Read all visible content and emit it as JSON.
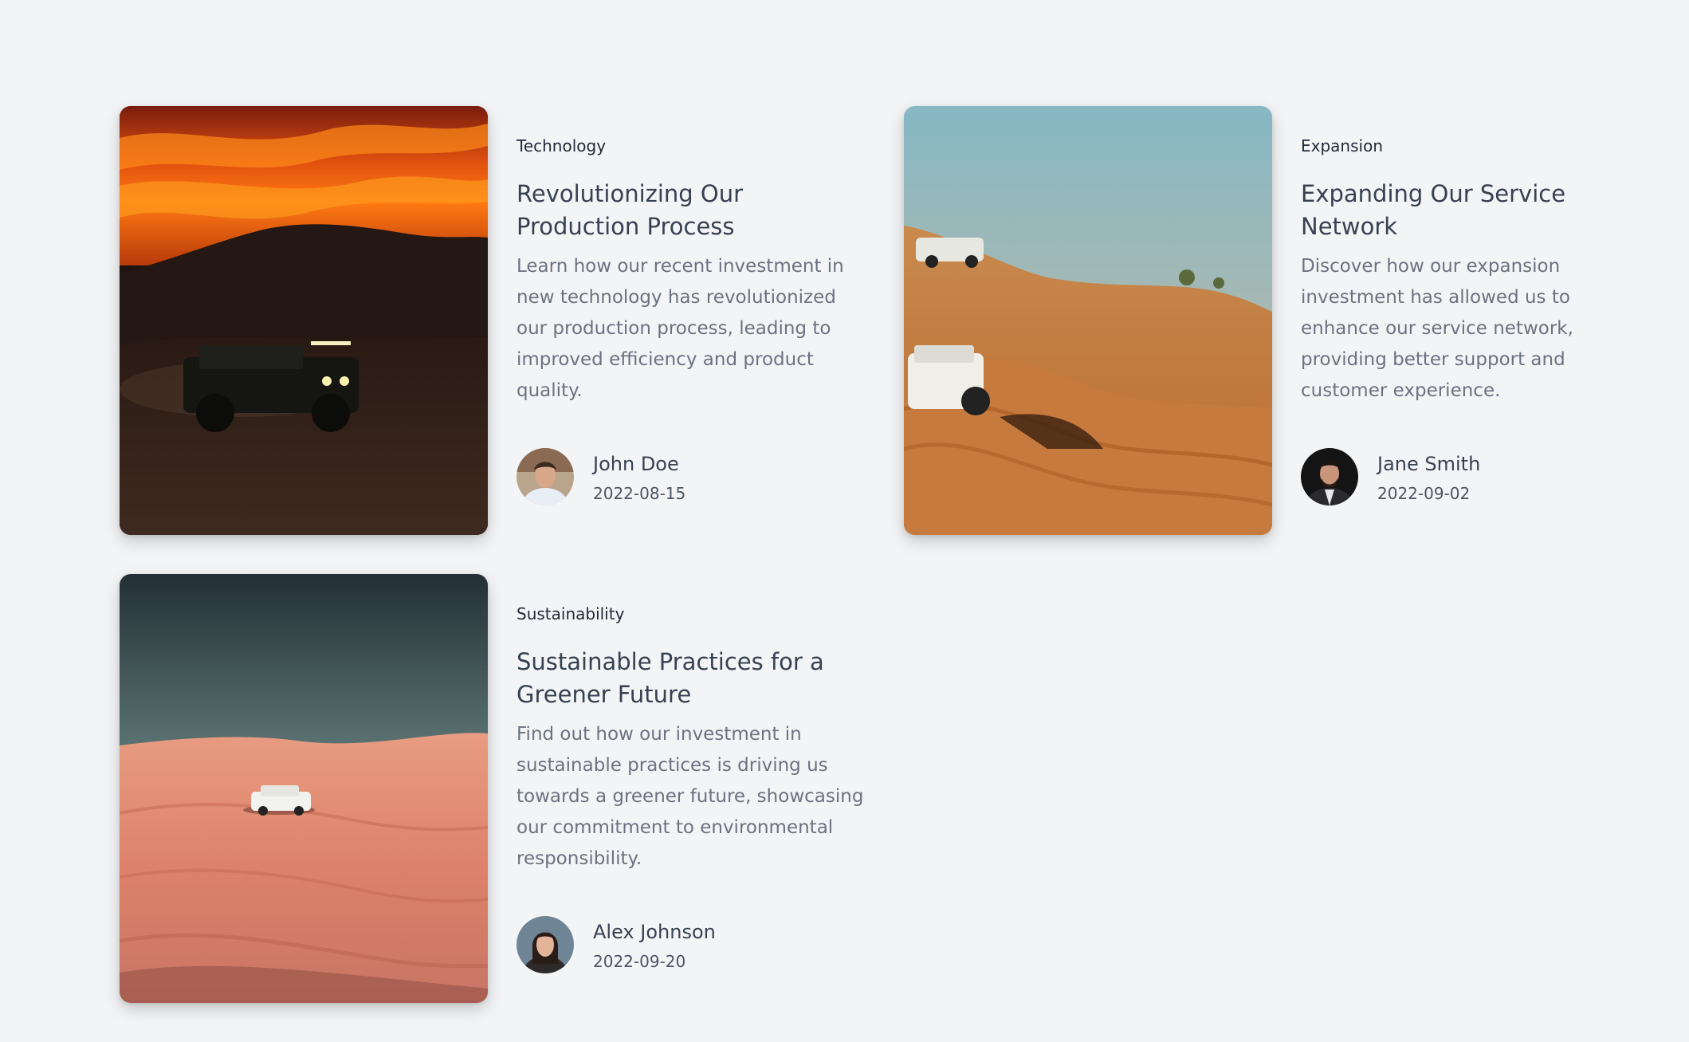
{
  "posts": [
    {
      "category": "Technology",
      "title": "Revolutionizing Our Production Process",
      "excerpt": "Learn how our recent investment in new technology has revolutionized our production process, leading to improved efficiency and product quality.",
      "author": "John Doe",
      "date": "2022-08-15"
    },
    {
      "category": "Expansion",
      "title": "Expanding Our Service Network",
      "excerpt": "Discover how our expansion investment has allowed us to enhance our service network, providing better support and customer experience.",
      "author": "Jane Smith",
      "date": "2022-09-02"
    },
    {
      "category": "Sustainability",
      "title": "Sustainable Practices for a Greener Future",
      "excerpt": "Find out how our investment in sustainable practices is driving us towards a greener future, showcasing our commitment to environmental responsibility.",
      "author": "Alex Johnson",
      "date": "2022-09-20"
    }
  ],
  "colors": {
    "page_background": "#f3f4f6",
    "heading": "#374151",
    "body_text": "#6b7280"
  }
}
